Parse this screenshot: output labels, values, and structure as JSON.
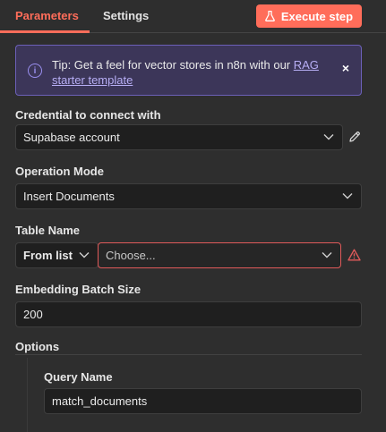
{
  "tabs": [
    {
      "label": "Parameters",
      "active": true
    },
    {
      "label": "Settings",
      "active": false
    }
  ],
  "execute_button": {
    "label": "Execute step",
    "icon": "flask-icon"
  },
  "tip": {
    "prefix": "Tip: Get a feel for vector stores in n8n with our ",
    "link": "RAG starter template",
    "close": "×",
    "info_icon": "i"
  },
  "credential": {
    "label": "Credential to connect with",
    "value": "Supabase account"
  },
  "operation_mode": {
    "label": "Operation Mode",
    "value": "Insert Documents"
  },
  "table_name": {
    "label": "Table Name",
    "mode": "From list",
    "placeholder": "Choose..."
  },
  "embedding_batch_size": {
    "label": "Embedding Batch Size",
    "value": "200"
  },
  "options": {
    "label": "Options"
  },
  "query_name": {
    "label": "Query Name",
    "value": "match_documents"
  },
  "colors": {
    "accent": "#ff6d5a",
    "tip_bg": "#3c3659",
    "error": "#e05a5a"
  }
}
